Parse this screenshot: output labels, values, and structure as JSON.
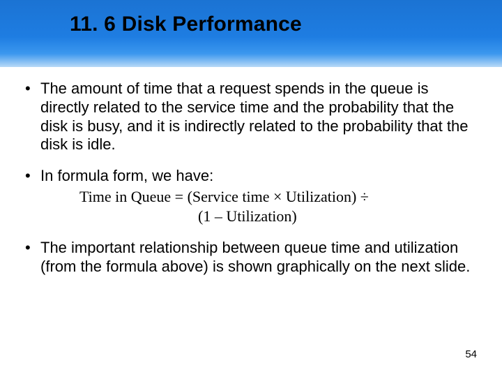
{
  "header": {
    "title": "11. 6 Disk Performance"
  },
  "bullets": {
    "b1": "The amount of time that a request spends in the queue is directly related to the service time and the probability that the disk is busy, and it is indirectly related to the probability that the disk is idle.",
    "b2": "In formula form, we have:",
    "b3": "The important relationship between queue time and utilization (from the formula above) is shown graphically on the next slide."
  },
  "formula": {
    "line1": "Time in Queue = (Service time × Utilization) ÷",
    "line2": "(1 – Utilization)"
  },
  "page": "54"
}
